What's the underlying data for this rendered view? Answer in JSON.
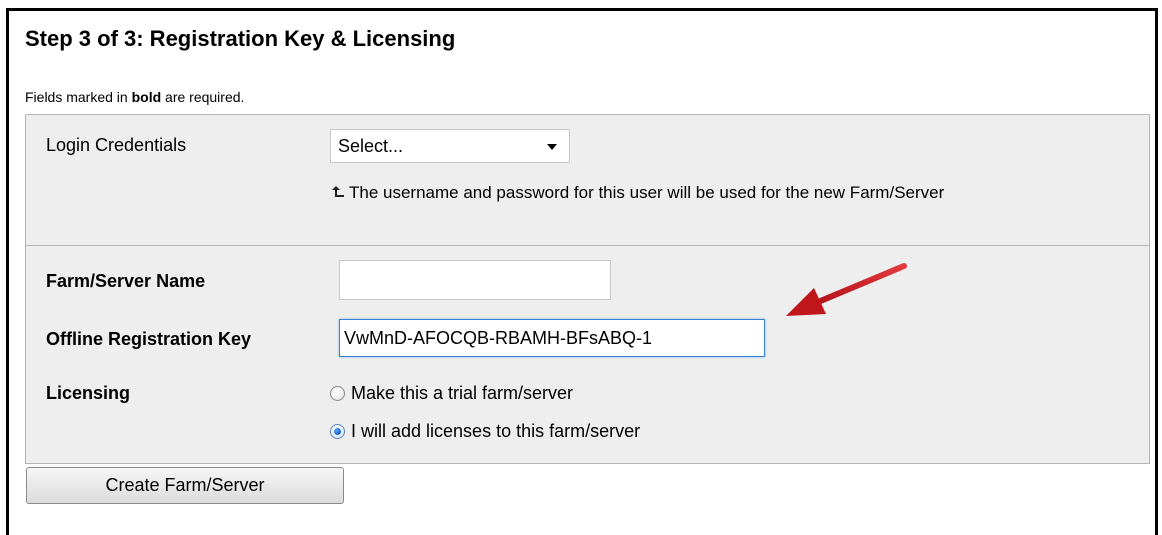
{
  "step_title": "Step 3 of 3: Registration Key & Licensing",
  "required_note": {
    "prefix": "Fields marked in ",
    "bold_word": "bold",
    "suffix": " are required."
  },
  "login_credentials": {
    "label": "Login Credentials",
    "selected_value": "Select...",
    "hint_icon": "up-arrow-icon",
    "hint": "The username and password for this user will be used for the new Farm/Server"
  },
  "farm_server_name": {
    "label": "Farm/Server Name",
    "value": ""
  },
  "offline_registration_key": {
    "label": "Offline Registration Key",
    "value": "VwMnD-AFOCQB-RBAMH-BFsABQ-1"
  },
  "licensing": {
    "label": "Licensing",
    "options": [
      {
        "label": "Make this a trial farm/server",
        "checked": false
      },
      {
        "label": "I will add licenses to this farm/server",
        "checked": true
      }
    ]
  },
  "submit_button": "Create Farm/Server",
  "colors": {
    "section_bg": "#eeeeee",
    "section_border": "#b5b5b5",
    "annotation_arrow": "#c0161b",
    "focus_border": "#3c80d0"
  }
}
